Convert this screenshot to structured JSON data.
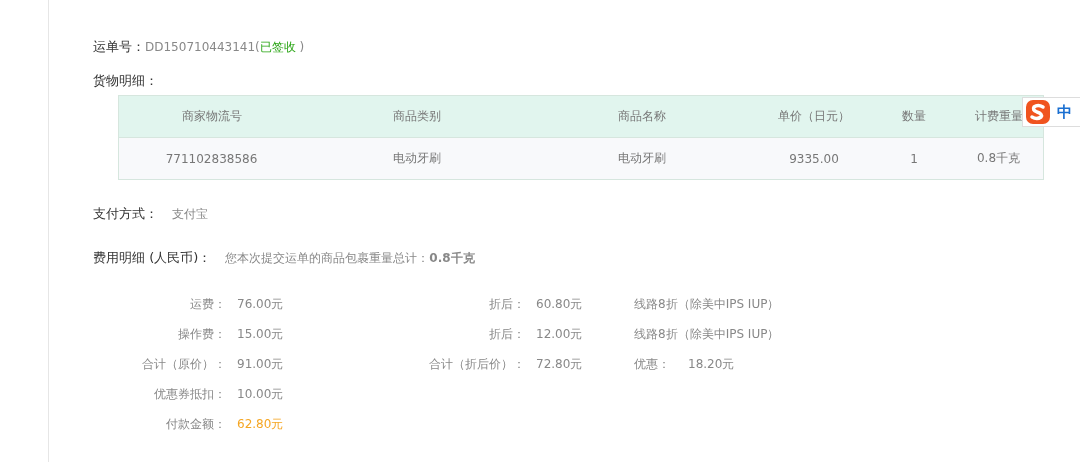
{
  "waybill": {
    "label": "运单号：",
    "number": "DD150710443141(",
    "status": "已签收",
    "close": ")"
  },
  "goods": {
    "label": "货物明细：",
    "columns": [
      "商家物流号",
      "商品类别",
      "商品名称",
      "单价（日元）",
      "数量",
      "计费重量"
    ],
    "rows": [
      [
        "771102838586",
        "电动牙刷",
        "电动牙刷",
        "9335.00",
        "1",
        "0.8千克"
      ]
    ]
  },
  "payment": {
    "label": "支付方式：",
    "value": "支付宝"
  },
  "fees": {
    "label": "费用明细 (人民币)：",
    "summary": "您本次提交运单的商品包裹重量总计：**0.8千克**",
    "rows": [
      {
        "label": "运费：",
        "value": "76.00元",
        "kind": "plain",
        "discount_label": "折后：",
        "discount_value": "60.80元",
        "note": {
          "kind": "text",
          "text": "线路8折（除美中IPS IUP）"
        }
      },
      {
        "label": "操作费：",
        "value": "15.00元",
        "kind": "plain",
        "discount_label": "折后：",
        "discount_value": "12.00元",
        "note": {
          "kind": "text",
          "text": "线路8折（除美中IPS IUP）"
        }
      },
      {
        "label": "合计（原价）：",
        "value": "91.00元",
        "kind": "plain",
        "discount_label": "合计（折后价）：",
        "discount_value": "72.80元",
        "note": {
          "kind": "pair",
          "label": "优惠：",
          "value": "18.20元"
        }
      },
      {
        "label": "优惠券抵扣：",
        "value": "10.00元",
        "kind": "plain"
      },
      {
        "label": "付款金额：",
        "value": "62.80元",
        "kind": "payable"
      }
    ]
  },
  "ime_badge": {
    "text": "中"
  }
}
